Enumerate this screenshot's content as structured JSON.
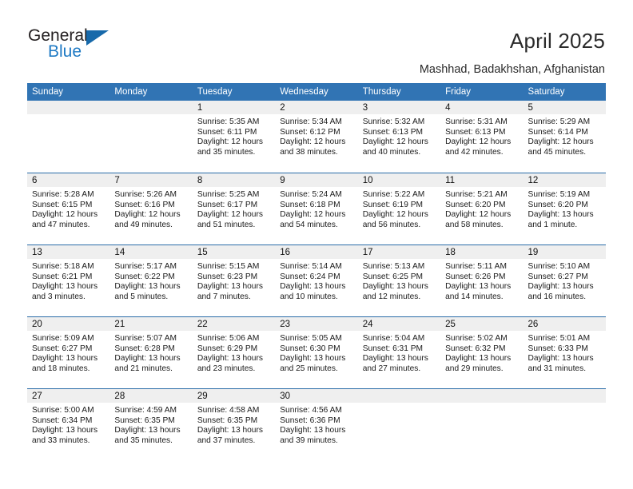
{
  "brand": {
    "name_part1": "General",
    "name_part2": "Blue",
    "triangle_color": "#1769aa",
    "blue_color": "#1f7ac4"
  },
  "header": {
    "title": "April 2025",
    "subtitle": "Mashhad, Badakhshan, Afghanistan",
    "header_bg": "#3174b4",
    "band_bg": "#efefef",
    "rule_color": "#2a6ca8"
  },
  "weekday_headers": [
    "Sunday",
    "Monday",
    "Tuesday",
    "Wednesday",
    "Thursday",
    "Friday",
    "Saturday"
  ],
  "weeks": [
    [
      {
        "day": "",
        "sunrise": "",
        "sunset": "",
        "daylight_line1": "",
        "daylight_line2": ""
      },
      {
        "day": "",
        "sunrise": "",
        "sunset": "",
        "daylight_line1": "",
        "daylight_line2": ""
      },
      {
        "day": "1",
        "sunrise": "Sunrise: 5:35 AM",
        "sunset": "Sunset: 6:11 PM",
        "daylight_line1": "Daylight: 12 hours",
        "daylight_line2": "and 35 minutes."
      },
      {
        "day": "2",
        "sunrise": "Sunrise: 5:34 AM",
        "sunset": "Sunset: 6:12 PM",
        "daylight_line1": "Daylight: 12 hours",
        "daylight_line2": "and 38 minutes."
      },
      {
        "day": "3",
        "sunrise": "Sunrise: 5:32 AM",
        "sunset": "Sunset: 6:13 PM",
        "daylight_line1": "Daylight: 12 hours",
        "daylight_line2": "and 40 minutes."
      },
      {
        "day": "4",
        "sunrise": "Sunrise: 5:31 AM",
        "sunset": "Sunset: 6:13 PM",
        "daylight_line1": "Daylight: 12 hours",
        "daylight_line2": "and 42 minutes."
      },
      {
        "day": "5",
        "sunrise": "Sunrise: 5:29 AM",
        "sunset": "Sunset: 6:14 PM",
        "daylight_line1": "Daylight: 12 hours",
        "daylight_line2": "and 45 minutes."
      }
    ],
    [
      {
        "day": "6",
        "sunrise": "Sunrise: 5:28 AM",
        "sunset": "Sunset: 6:15 PM",
        "daylight_line1": "Daylight: 12 hours",
        "daylight_line2": "and 47 minutes."
      },
      {
        "day": "7",
        "sunrise": "Sunrise: 5:26 AM",
        "sunset": "Sunset: 6:16 PM",
        "daylight_line1": "Daylight: 12 hours",
        "daylight_line2": "and 49 minutes."
      },
      {
        "day": "8",
        "sunrise": "Sunrise: 5:25 AM",
        "sunset": "Sunset: 6:17 PM",
        "daylight_line1": "Daylight: 12 hours",
        "daylight_line2": "and 51 minutes."
      },
      {
        "day": "9",
        "sunrise": "Sunrise: 5:24 AM",
        "sunset": "Sunset: 6:18 PM",
        "daylight_line1": "Daylight: 12 hours",
        "daylight_line2": "and 54 minutes."
      },
      {
        "day": "10",
        "sunrise": "Sunrise: 5:22 AM",
        "sunset": "Sunset: 6:19 PM",
        "daylight_line1": "Daylight: 12 hours",
        "daylight_line2": "and 56 minutes."
      },
      {
        "day": "11",
        "sunrise": "Sunrise: 5:21 AM",
        "sunset": "Sunset: 6:20 PM",
        "daylight_line1": "Daylight: 12 hours",
        "daylight_line2": "and 58 minutes."
      },
      {
        "day": "12",
        "sunrise": "Sunrise: 5:19 AM",
        "sunset": "Sunset: 6:20 PM",
        "daylight_line1": "Daylight: 13 hours",
        "daylight_line2": "and 1 minute."
      }
    ],
    [
      {
        "day": "13",
        "sunrise": "Sunrise: 5:18 AM",
        "sunset": "Sunset: 6:21 PM",
        "daylight_line1": "Daylight: 13 hours",
        "daylight_line2": "and 3 minutes."
      },
      {
        "day": "14",
        "sunrise": "Sunrise: 5:17 AM",
        "sunset": "Sunset: 6:22 PM",
        "daylight_line1": "Daylight: 13 hours",
        "daylight_line2": "and 5 minutes."
      },
      {
        "day": "15",
        "sunrise": "Sunrise: 5:15 AM",
        "sunset": "Sunset: 6:23 PM",
        "daylight_line1": "Daylight: 13 hours",
        "daylight_line2": "and 7 minutes."
      },
      {
        "day": "16",
        "sunrise": "Sunrise: 5:14 AM",
        "sunset": "Sunset: 6:24 PM",
        "daylight_line1": "Daylight: 13 hours",
        "daylight_line2": "and 10 minutes."
      },
      {
        "day": "17",
        "sunrise": "Sunrise: 5:13 AM",
        "sunset": "Sunset: 6:25 PM",
        "daylight_line1": "Daylight: 13 hours",
        "daylight_line2": "and 12 minutes."
      },
      {
        "day": "18",
        "sunrise": "Sunrise: 5:11 AM",
        "sunset": "Sunset: 6:26 PM",
        "daylight_line1": "Daylight: 13 hours",
        "daylight_line2": "and 14 minutes."
      },
      {
        "day": "19",
        "sunrise": "Sunrise: 5:10 AM",
        "sunset": "Sunset: 6:27 PM",
        "daylight_line1": "Daylight: 13 hours",
        "daylight_line2": "and 16 minutes."
      }
    ],
    [
      {
        "day": "20",
        "sunrise": "Sunrise: 5:09 AM",
        "sunset": "Sunset: 6:27 PM",
        "daylight_line1": "Daylight: 13 hours",
        "daylight_line2": "and 18 minutes."
      },
      {
        "day": "21",
        "sunrise": "Sunrise: 5:07 AM",
        "sunset": "Sunset: 6:28 PM",
        "daylight_line1": "Daylight: 13 hours",
        "daylight_line2": "and 21 minutes."
      },
      {
        "day": "22",
        "sunrise": "Sunrise: 5:06 AM",
        "sunset": "Sunset: 6:29 PM",
        "daylight_line1": "Daylight: 13 hours",
        "daylight_line2": "and 23 minutes."
      },
      {
        "day": "23",
        "sunrise": "Sunrise: 5:05 AM",
        "sunset": "Sunset: 6:30 PM",
        "daylight_line1": "Daylight: 13 hours",
        "daylight_line2": "and 25 minutes."
      },
      {
        "day": "24",
        "sunrise": "Sunrise: 5:04 AM",
        "sunset": "Sunset: 6:31 PM",
        "daylight_line1": "Daylight: 13 hours",
        "daylight_line2": "and 27 minutes."
      },
      {
        "day": "25",
        "sunrise": "Sunrise: 5:02 AM",
        "sunset": "Sunset: 6:32 PM",
        "daylight_line1": "Daylight: 13 hours",
        "daylight_line2": "and 29 minutes."
      },
      {
        "day": "26",
        "sunrise": "Sunrise: 5:01 AM",
        "sunset": "Sunset: 6:33 PM",
        "daylight_line1": "Daylight: 13 hours",
        "daylight_line2": "and 31 minutes."
      }
    ],
    [
      {
        "day": "27",
        "sunrise": "Sunrise: 5:00 AM",
        "sunset": "Sunset: 6:34 PM",
        "daylight_line1": "Daylight: 13 hours",
        "daylight_line2": "and 33 minutes."
      },
      {
        "day": "28",
        "sunrise": "Sunrise: 4:59 AM",
        "sunset": "Sunset: 6:35 PM",
        "daylight_line1": "Daylight: 13 hours",
        "daylight_line2": "and 35 minutes."
      },
      {
        "day": "29",
        "sunrise": "Sunrise: 4:58 AM",
        "sunset": "Sunset: 6:35 PM",
        "daylight_line1": "Daylight: 13 hours",
        "daylight_line2": "and 37 minutes."
      },
      {
        "day": "30",
        "sunrise": "Sunrise: 4:56 AM",
        "sunset": "Sunset: 6:36 PM",
        "daylight_line1": "Daylight: 13 hours",
        "daylight_line2": "and 39 minutes."
      },
      {
        "day": "",
        "sunrise": "",
        "sunset": "",
        "daylight_line1": "",
        "daylight_line2": ""
      },
      {
        "day": "",
        "sunrise": "",
        "sunset": "",
        "daylight_line1": "",
        "daylight_line2": ""
      },
      {
        "day": "",
        "sunrise": "",
        "sunset": "",
        "daylight_line1": "",
        "daylight_line2": ""
      }
    ]
  ]
}
